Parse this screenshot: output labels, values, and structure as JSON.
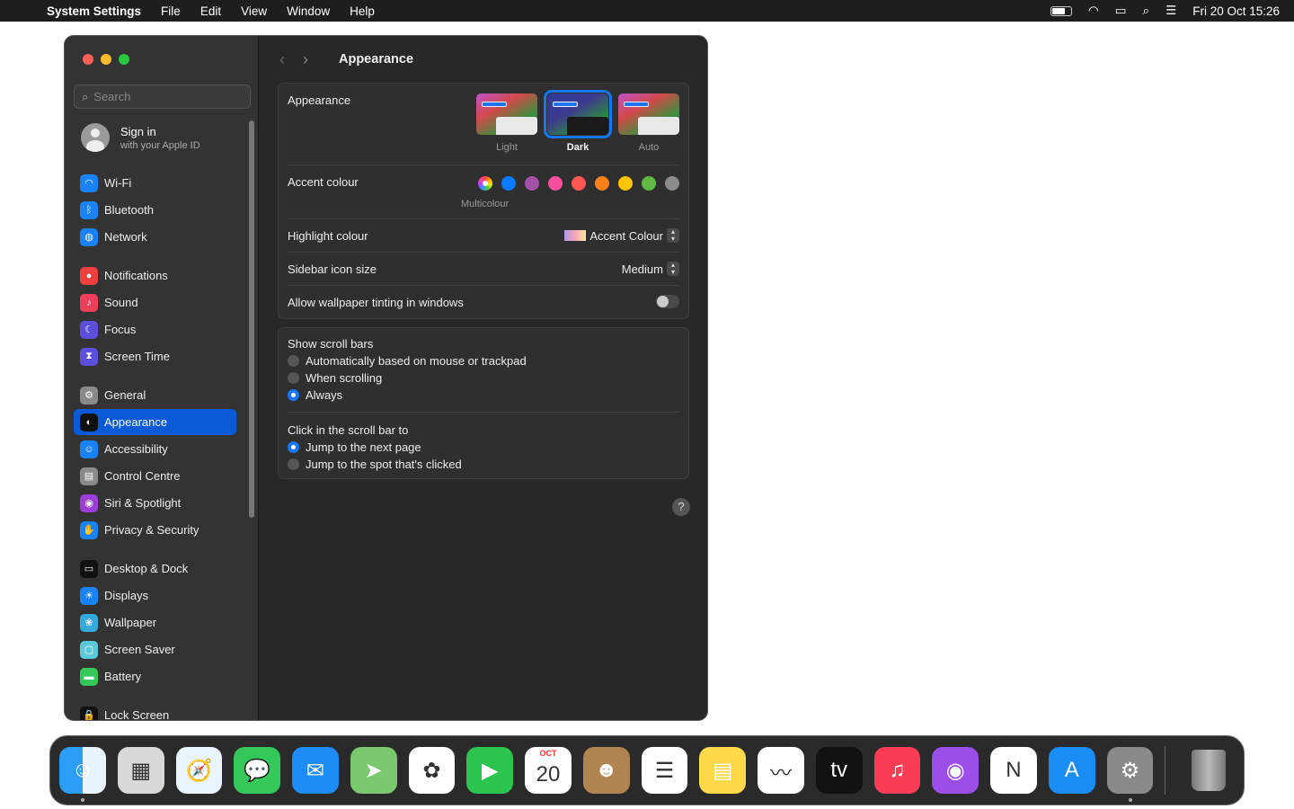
{
  "menubar": {
    "app": "System Settings",
    "menus": [
      "File",
      "Edit",
      "View",
      "Window",
      "Help"
    ],
    "status_icons": [
      "battery-icon",
      "wifi-icon",
      "screen-mirroring-icon",
      "search-icon",
      "control-centre-icon"
    ],
    "clock": "Fri 20 Oct  15:26"
  },
  "sidebar": {
    "search_placeholder": "Search",
    "signin_title": "Sign in",
    "signin_sub": "with your Apple ID",
    "items": [
      {
        "label": "Wi-Fi",
        "color": "#1a82f7",
        "glyph": "◠"
      },
      {
        "label": "Bluetooth",
        "color": "#1a82f7",
        "glyph": "ᛒ"
      },
      {
        "label": "Network",
        "color": "#1a82f7",
        "glyph": "◍"
      },
      {
        "label": "Notifications",
        "color": "#ee3f3f",
        "glyph": "●"
      },
      {
        "label": "Sound",
        "color": "#ee3f5a",
        "glyph": "♪"
      },
      {
        "label": "Focus",
        "color": "#5b4fdc",
        "glyph": "☾"
      },
      {
        "label": "Screen Time",
        "color": "#5b4fdc",
        "glyph": "⧗"
      },
      {
        "label": "General",
        "color": "#8a8a8a",
        "glyph": "⚙"
      },
      {
        "label": "Appearance",
        "color": "#111111",
        "glyph": "◐",
        "selected": true
      },
      {
        "label": "Accessibility",
        "color": "#1a82f7",
        "glyph": "☺"
      },
      {
        "label": "Control Centre",
        "color": "#8a8a8a",
        "glyph": "▤"
      },
      {
        "label": "Siri & Spotlight",
        "color": "#9b3fd6",
        "glyph": "◉"
      },
      {
        "label": "Privacy & Security",
        "color": "#1a82f7",
        "glyph": "✋"
      },
      {
        "label": "Desktop & Dock",
        "color": "#111111",
        "glyph": "▭"
      },
      {
        "label": "Displays",
        "color": "#1a82f7",
        "glyph": "☀"
      },
      {
        "label": "Wallpaper",
        "color": "#34aadc",
        "glyph": "❀"
      },
      {
        "label": "Screen Saver",
        "color": "#5ac8d8",
        "glyph": "▢"
      },
      {
        "label": "Battery",
        "color": "#34c759",
        "glyph": "▬"
      },
      {
        "label": "Lock Screen",
        "color": "#111111",
        "glyph": "🔒"
      }
    ]
  },
  "main": {
    "title": "Appearance",
    "appearance_label": "Appearance",
    "modes": [
      {
        "label": "Light"
      },
      {
        "label": "Dark",
        "selected": true
      },
      {
        "label": "Auto"
      }
    ],
    "accent_label": "Accent colour",
    "accent_colors": [
      "multicolour",
      "#0a7aff",
      "#a550a7",
      "#f74f9e",
      "#fc5753",
      "#f7821b",
      "#ffc600",
      "#62ba46",
      "#8c8c8c"
    ],
    "accent_selected": "Multicolour",
    "highlight_label": "Highlight colour",
    "highlight_value": "Accent Colour",
    "icon_size_label": "Sidebar icon size",
    "icon_size_value": "Medium",
    "tinting_label": "Allow wallpaper tinting in windows",
    "tinting_on": false,
    "scroll_label": "Show scroll bars",
    "scroll_options": [
      "Automatically based on mouse or trackpad",
      "When scrolling",
      "Always"
    ],
    "scroll_selected": 2,
    "click_label": "Click in the scroll bar to",
    "click_options": [
      "Jump to the next page",
      "Jump to the spot that's clicked"
    ],
    "click_selected": 0
  },
  "dock": {
    "apps": [
      {
        "name": "finder",
        "bg": "linear-gradient(90deg,#2a9df4 50%,#e8f3fb 50%)",
        "glyph": "☺",
        "running": true
      },
      {
        "name": "launchpad",
        "bg": "#d8d8d8",
        "glyph": "▦"
      },
      {
        "name": "safari",
        "bg": "#e9f4ff",
        "glyph": "🧭"
      },
      {
        "name": "messages",
        "bg": "#34c759",
        "glyph": "💬"
      },
      {
        "name": "mail",
        "bg": "#1e8cf5",
        "glyph": "✉"
      },
      {
        "name": "maps",
        "bg": "#7bc96f",
        "glyph": "➤"
      },
      {
        "name": "photos",
        "bg": "#ffffff",
        "glyph": "✿"
      },
      {
        "name": "facetime",
        "bg": "#2bc44f",
        "glyph": "▶"
      },
      {
        "name": "calendar",
        "bg": "#ffffff",
        "glyph": "20",
        "month": "OCT"
      },
      {
        "name": "contacts",
        "bg": "#b08552",
        "glyph": "☻"
      },
      {
        "name": "reminders",
        "bg": "#ffffff",
        "glyph": "☰"
      },
      {
        "name": "notes",
        "bg": "#ffd94a",
        "glyph": "▤"
      },
      {
        "name": "freeform",
        "bg": "#ffffff",
        "glyph": "〰"
      },
      {
        "name": "tv",
        "bg": "#111111",
        "glyph": "tv"
      },
      {
        "name": "music",
        "bg": "#fa3c55",
        "glyph": "♫"
      },
      {
        "name": "podcasts",
        "bg": "#9c4ee8",
        "glyph": "◉"
      },
      {
        "name": "news",
        "bg": "#ffffff",
        "glyph": "N"
      },
      {
        "name": "app-store",
        "bg": "#1a8cf5",
        "glyph": "A"
      },
      {
        "name": "system-settings",
        "bg": "#8a8a8a",
        "glyph": "⚙",
        "running": true
      }
    ],
    "trash": "trash"
  }
}
